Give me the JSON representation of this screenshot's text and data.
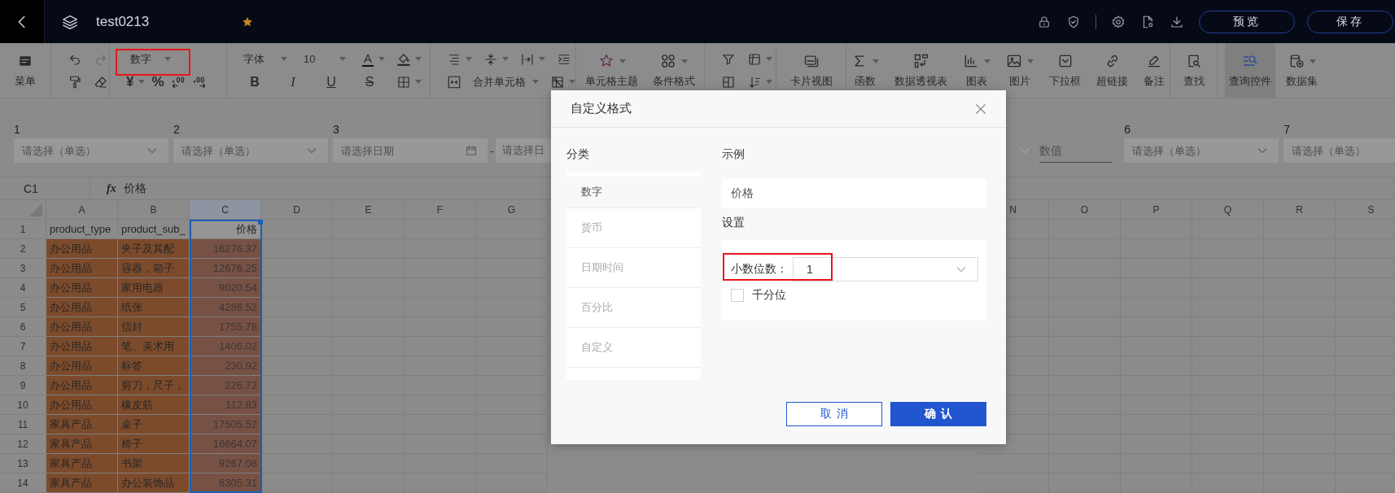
{
  "topbar": {
    "title": "test0213",
    "starred": true,
    "buttons": [
      "预览",
      "保存"
    ]
  },
  "toolbar": {
    "menu": "菜单",
    "number_format": "数字",
    "currency": "¥",
    "percent": "%",
    "font": "字体",
    "font_size": "10",
    "font_color": "A",
    "styles": [
      "B",
      "I",
      "U",
      "S"
    ],
    "merge": "合并单元格",
    "tools": [
      {
        "label": "单元格主题",
        "selected": false
      },
      {
        "label": "条件格式",
        "selected": false
      },
      {
        "label": "卡片视图",
        "selected": false
      },
      {
        "label": "函数",
        "selected": false
      },
      {
        "label": "数据透视表",
        "selected": false
      },
      {
        "label": "图表",
        "selected": false
      },
      {
        "label": "图片",
        "selected": false
      },
      {
        "label": "下拉框",
        "selected": false
      },
      {
        "label": "超链接",
        "selected": false
      },
      {
        "label": "备注",
        "selected": false
      },
      {
        "label": "查找",
        "selected": false
      },
      {
        "label": "查询控件",
        "selected": true
      },
      {
        "label": "数据集",
        "selected": false
      }
    ]
  },
  "filters_left": [
    {
      "label": "1",
      "kind": "select",
      "placeholder": "请选择（单选）"
    },
    {
      "label": "2",
      "kind": "select",
      "placeholder": "请选择（单选）"
    },
    {
      "label": "3",
      "kind": "daterange",
      "placeholder": "请选择日期",
      "separator": "-",
      "placeholder_end": "请选择日"
    }
  ],
  "filters_right": [
    {
      "kind": "number",
      "placeholder": "数值"
    },
    {
      "label": "6",
      "kind": "select",
      "placeholder": "请选择（单选）"
    },
    {
      "label": "7",
      "kind": "select",
      "placeholder": "请选择（单选）"
    }
  ],
  "formula_bar": {
    "cell": "C1",
    "fx": "fx",
    "value": "价格"
  },
  "sheet": {
    "columns_left": [
      {
        "letter": "A",
        "selected": false
      },
      {
        "letter": "B",
        "selected": false
      },
      {
        "letter": "C",
        "selected": true
      },
      {
        "letter": "D",
        "selected": false
      },
      {
        "letter": "E",
        "selected": false
      },
      {
        "letter": "F",
        "selected": false
      },
      {
        "letter": "G",
        "selected": false
      }
    ],
    "columns_right": [
      {
        "letter": "N",
        "selected": false
      },
      {
        "letter": "O",
        "selected": false
      },
      {
        "letter": "P",
        "selected": false
      },
      {
        "letter": "Q",
        "selected": false
      },
      {
        "letter": "R",
        "selected": false
      },
      {
        "letter": "S",
        "selected": false
      }
    ],
    "rows": [
      {
        "number": "1",
        "shaded": false,
        "cells": [
          "product_type",
          "product_sub_",
          "价格"
        ]
      },
      {
        "number": "2",
        "shaded": true,
        "cells": [
          "办公用品",
          "夹子及其配",
          "16276.37"
        ]
      },
      {
        "number": "3",
        "shaded": true,
        "cells": [
          "办公用品",
          "容器，箱子",
          "12676.25"
        ]
      },
      {
        "number": "4",
        "shaded": true,
        "cells": [
          "办公用品",
          "家用电器",
          "9020.54"
        ]
      },
      {
        "number": "5",
        "shaded": true,
        "cells": [
          "办公用品",
          "纸张",
          "4286.52"
        ]
      },
      {
        "number": "6",
        "shaded": true,
        "cells": [
          "办公用品",
          "信封",
          "1755.78"
        ]
      },
      {
        "number": "7",
        "shaded": true,
        "cells": [
          "办公用品",
          "笔、美术用",
          "1406.02"
        ]
      },
      {
        "number": "8",
        "shaded": true,
        "cells": [
          "办公用品",
          "标签",
          "230.92"
        ]
      },
      {
        "number": "9",
        "shaded": true,
        "cells": [
          "办公用品",
          "剪刀，尺子，",
          "226.72"
        ]
      },
      {
        "number": "10",
        "shaded": true,
        "cells": [
          "办公用品",
          "橡皮筋",
          "112.83"
        ]
      },
      {
        "number": "11",
        "shaded": true,
        "cells": [
          "家具产品",
          "桌子",
          "17505.52"
        ]
      },
      {
        "number": "12",
        "shaded": true,
        "cells": [
          "家具产品",
          "椅子",
          "16664.07"
        ]
      },
      {
        "number": "13",
        "shaded": true,
        "cells": [
          "家具产品",
          "书架",
          "9267.08"
        ]
      },
      {
        "number": "14",
        "shaded": true,
        "cells": [
          "家具产品",
          "办公装饰品",
          "6305.31"
        ]
      }
    ]
  },
  "dialog": {
    "title": "自定义格式",
    "category_heading": "分类",
    "categories": [
      {
        "label": "数字",
        "selected": true
      },
      {
        "label": "货币",
        "selected": false
      },
      {
        "label": "日期时间",
        "selected": false
      },
      {
        "label": "百分比",
        "selected": false
      },
      {
        "label": "自定义",
        "selected": false
      }
    ],
    "sample_heading": "示例",
    "sample": "价格",
    "settings_heading": "设置",
    "decimal_label": "小数位数：",
    "decimal_value": "1",
    "thousands_label": "千分位",
    "thousands_checked": false,
    "cancel": "取消",
    "confirm": "确认"
  }
}
